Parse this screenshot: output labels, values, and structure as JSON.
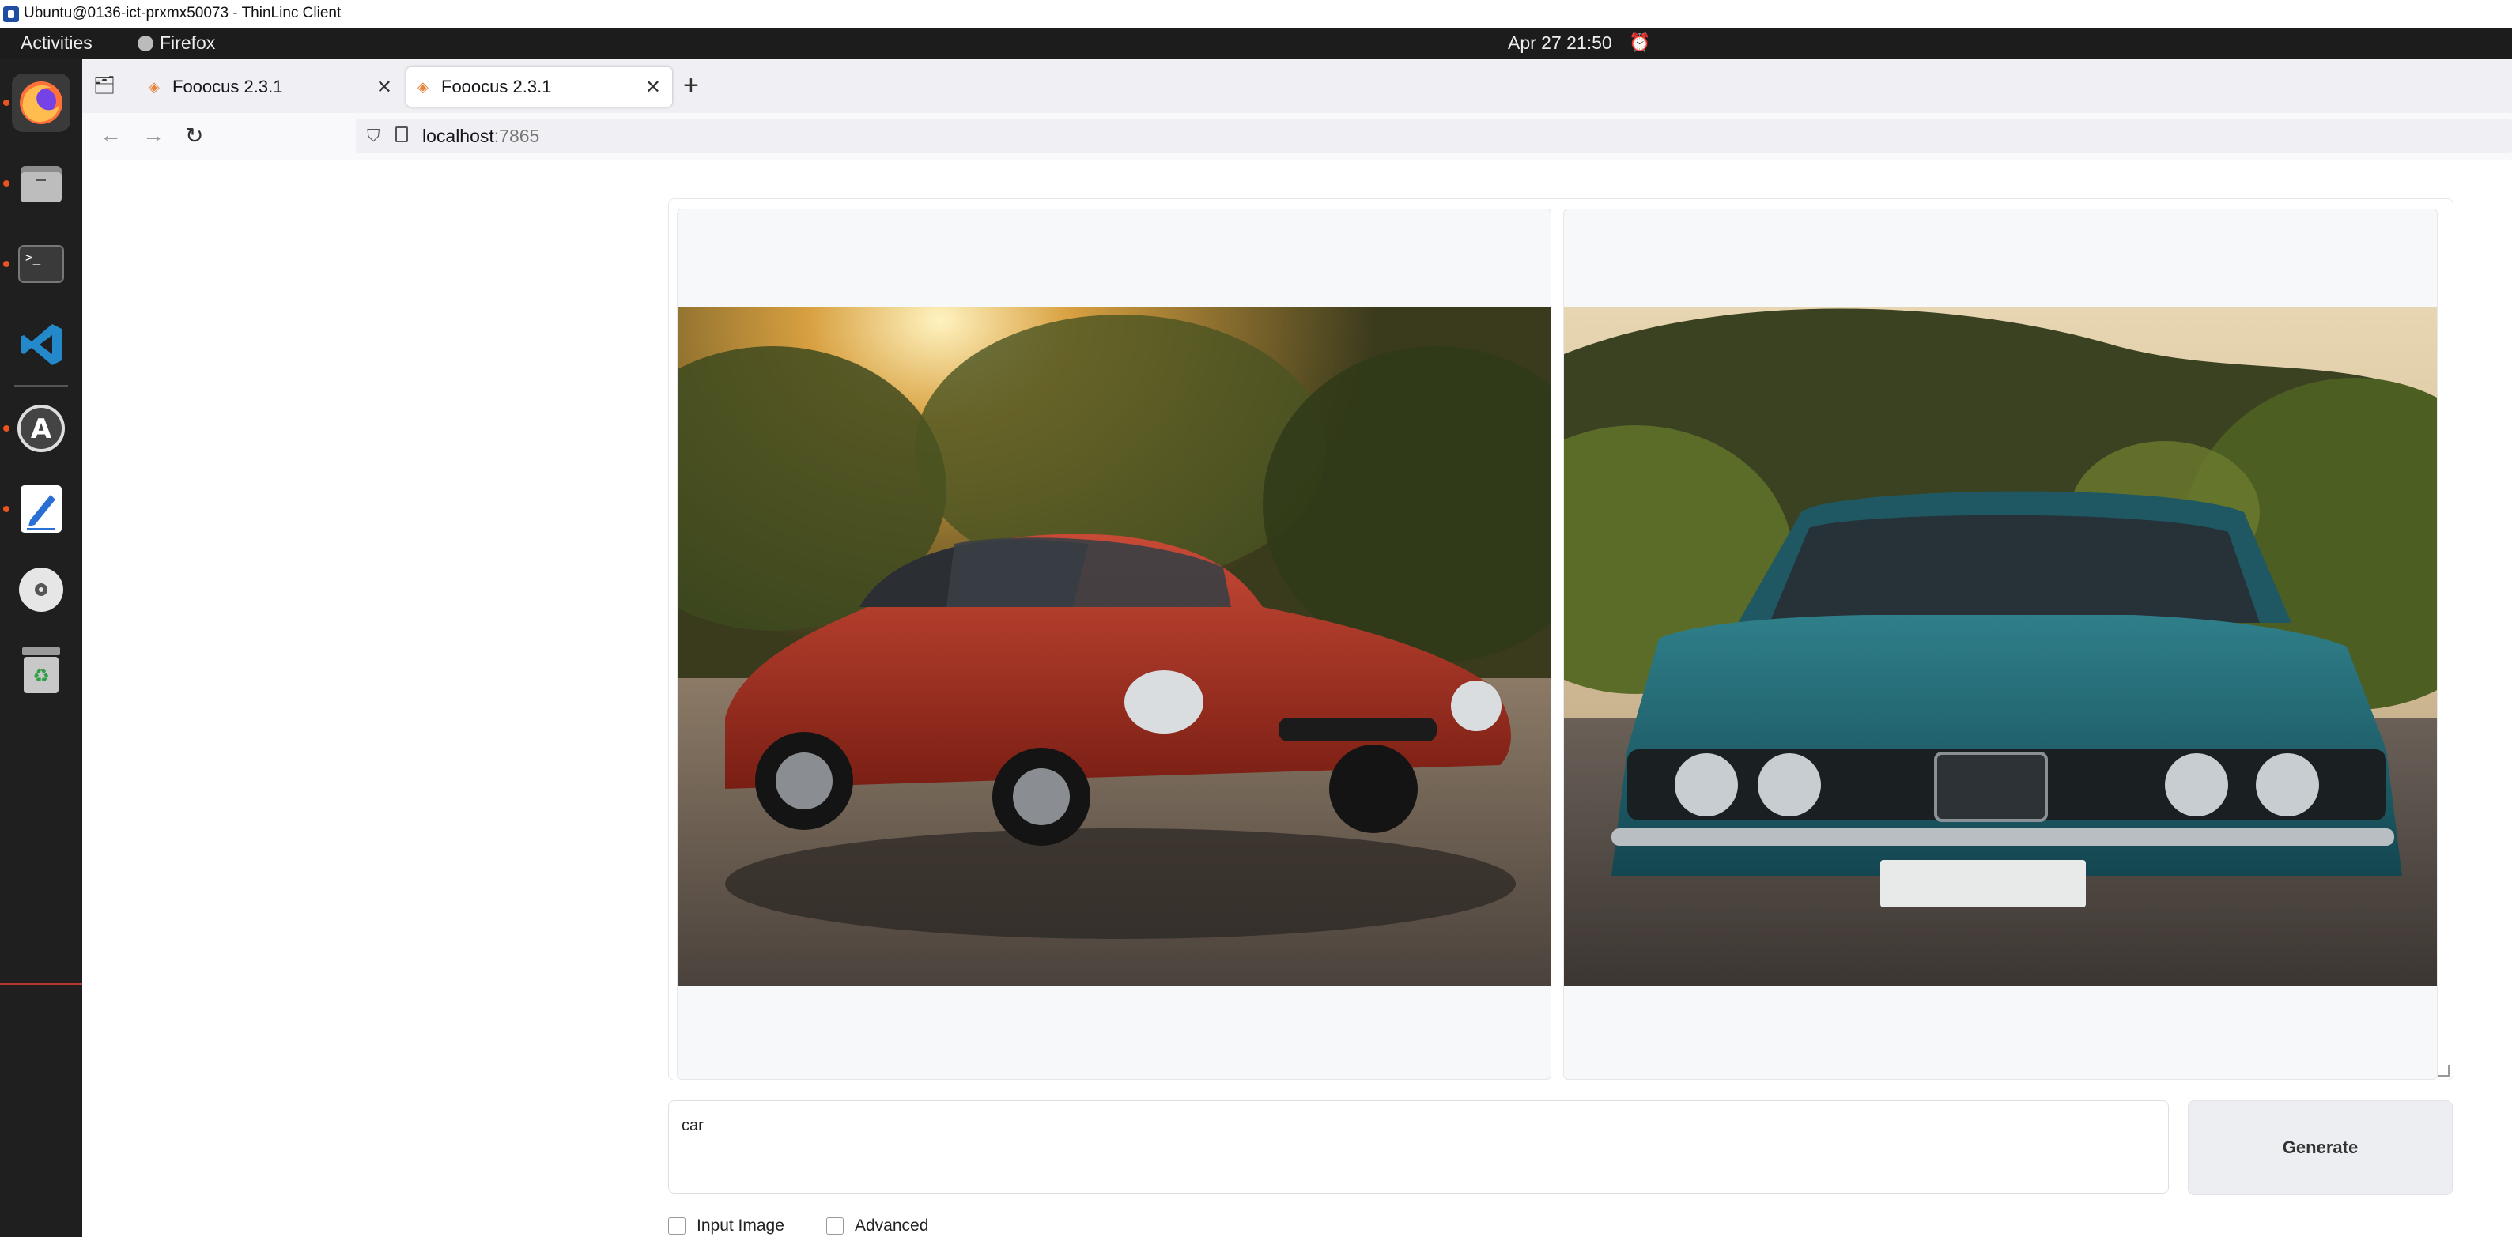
{
  "thinlinc": {
    "title": "Ubuntu@0136-ict-prxmx50073 - ThinLinc Client"
  },
  "topbar": {
    "activities": "Activities",
    "app": "Firefox",
    "clock": "Apr 27  21:50"
  },
  "dock": {
    "items": [
      "Firefox",
      "Files",
      "Terminal",
      "Visual Studio Code",
      "Software Updater",
      "Text Editor",
      "Disc",
      "Trash"
    ]
  },
  "tabs": [
    {
      "title": "Fooocus 2.3.1"
    },
    {
      "title": "Fooocus 2.3.1"
    }
  ],
  "url": {
    "host": "localhost",
    "port": ":7865"
  },
  "gallery": {
    "images": [
      "red classic sports car on road at sunset",
      "teal classic car front view on road"
    ]
  },
  "prompt": {
    "value": "car"
  },
  "generate": {
    "label": "Generate"
  },
  "options": {
    "input_image": "Input Image",
    "advanced": "Advanced"
  }
}
